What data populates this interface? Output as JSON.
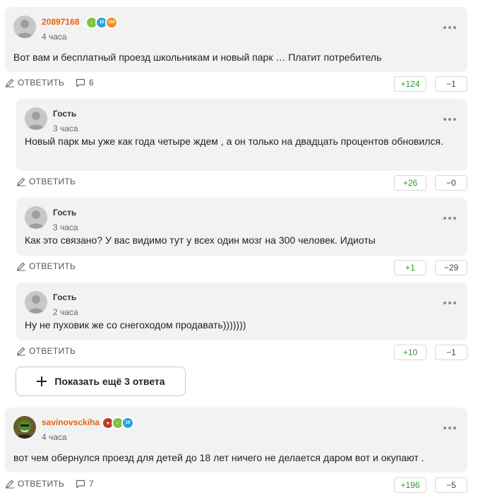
{
  "colors": {
    "card_bg": "#f2f2f2",
    "upvote": "#2e9a2e",
    "author_highlight": "#e8630a"
  },
  "comments": [
    {
      "author": "20897168",
      "time": "4 часа",
      "text": "Вот вам и бесплатный проезд школьникам и новый парк … Платит потребитель",
      "reply_label": "ОТВЕТИТЬ",
      "reply_count": "6",
      "upvotes": "+124",
      "downvotes": "−1",
      "badges": [
        "green-badge",
        "10",
        "100"
      ]
    },
    {
      "author": "Гость",
      "time": "3 часа",
      "text": "Новый парк мы уже как года четыре ждем , а он только на двадцать процентов обновился.",
      "reply_label": "ОТВЕТИТЬ",
      "upvotes": "+26",
      "downvotes": "−0"
    },
    {
      "author": "Гость",
      "time": "3 часа",
      "text": "Как это связано? У вас видимо тут у всех один мозг на 300 человек. Идиоты",
      "reply_label": "ОТВЕТИТЬ",
      "upvotes": "+1",
      "downvotes": "−29"
    },
    {
      "author": "Гость",
      "time": "2 часа",
      "text": "Ну не пуховик же со снегоходом продавать)))))))",
      "reply_label": "ОТВЕТИТЬ",
      "upvotes": "+10",
      "downvotes": "−1"
    },
    {
      "author": "savinovsckiha",
      "time": "4 часа",
      "text": "вот чем обернулся проезд для детей до 18 лет ничего не делается даром вот и окупают .",
      "reply_label": "ОТВЕТИТЬ",
      "reply_count": "7",
      "upvotes": "+196",
      "downvotes": "−5",
      "badges": [
        "gift-badge",
        "green-badge",
        "10"
      ]
    }
  ],
  "show_more_label": "Показать ещё 3 ответа"
}
